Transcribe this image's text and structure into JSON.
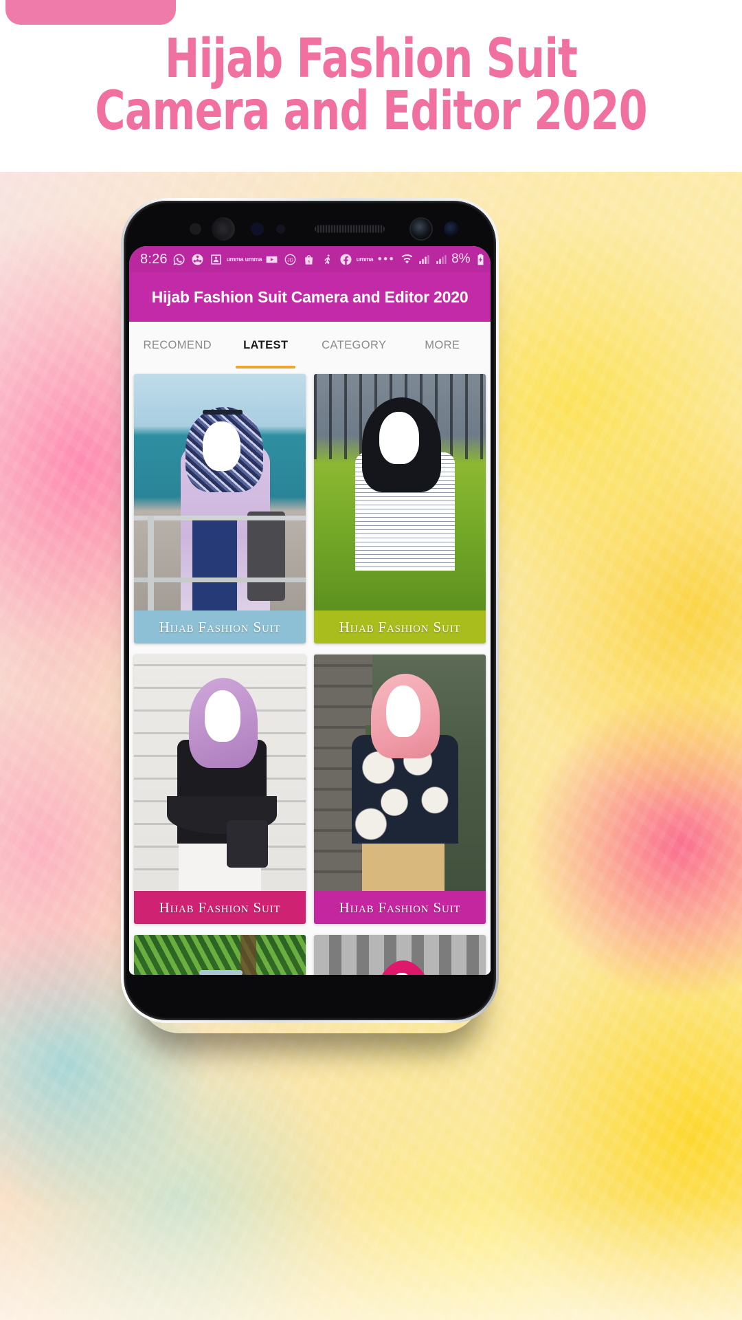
{
  "promo": {
    "title": "Hijab Fashion Suit\nCamera and Editor 2020",
    "pill_color": "#ef7bab",
    "title_color": "#f0709f"
  },
  "phone": {
    "statusbar": {
      "time": "8:26",
      "background": "#b9289f",
      "notification_icons": [
        {
          "name": "whatsapp-icon",
          "glyph": "whatsapp"
        },
        {
          "name": "shareit-icon",
          "glyph": "shareit"
        },
        {
          "name": "photo-frame-icon",
          "glyph": "photoframe"
        },
        {
          "name": "umma-icon",
          "glyph": "umma",
          "label": "umma"
        },
        {
          "name": "umma-icon-2",
          "glyph": "umma",
          "label": "umma"
        },
        {
          "name": "youtube-icon",
          "glyph": "youtube"
        },
        {
          "name": "jd-icon",
          "glyph": "jd",
          "label": "JD"
        },
        {
          "name": "shopee-icon",
          "glyph": "shopee",
          "label": "S"
        },
        {
          "name": "dance-icon",
          "glyph": "dance"
        },
        {
          "name": "facebook-icon",
          "glyph": "facebook"
        },
        {
          "name": "umma-icon-3",
          "glyph": "umma",
          "label": "umma"
        }
      ],
      "overflow_dots": "•••",
      "battery_percent": "8%",
      "right_icons": [
        "wifi-icon",
        "signal-sim1-icon",
        "signal-sim2-icon",
        "battery-charging-icon"
      ]
    },
    "appbar": {
      "title": "Hijab Fashion Suit Camera and Editor 2020",
      "background": "#c22aa8",
      "title_color": "#ffffff"
    },
    "tabs": {
      "active_index": 1,
      "indicator_color": "#f0a52a",
      "items": [
        {
          "label": "RECOMEND"
        },
        {
          "label": "LATEST"
        },
        {
          "label": "CATEGORY"
        },
        {
          "label": "MORE"
        }
      ]
    },
    "grid": {
      "cards": [
        {
          "label": "Hijab Fashion Suit",
          "label_color": "#8dc0d4",
          "photo": "seaside-navy-hijab-lilac-cardigan"
        },
        {
          "label": "Hijab Fashion Suit",
          "label_color": "#a9bd1c",
          "photo": "garden-black-hijab-checkered-shirt"
        },
        {
          "label": "Hijab Fashion Suit",
          "label_color": "#cf2273",
          "photo": "white-wall-lilac-hijab-black-peplum"
        },
        {
          "label": "Hijab Fashion Suit",
          "label_color": "#c4269f",
          "photo": "stone-wall-pink-hijab-floral-top"
        },
        {
          "label": "",
          "label_color": "#ffffff",
          "photo": "palm-leaves-pale-pink-hijab"
        },
        {
          "label": "",
          "label_color": "#ffffff",
          "photo": "grey-blinds-magenta-hijab"
        }
      ]
    }
  }
}
